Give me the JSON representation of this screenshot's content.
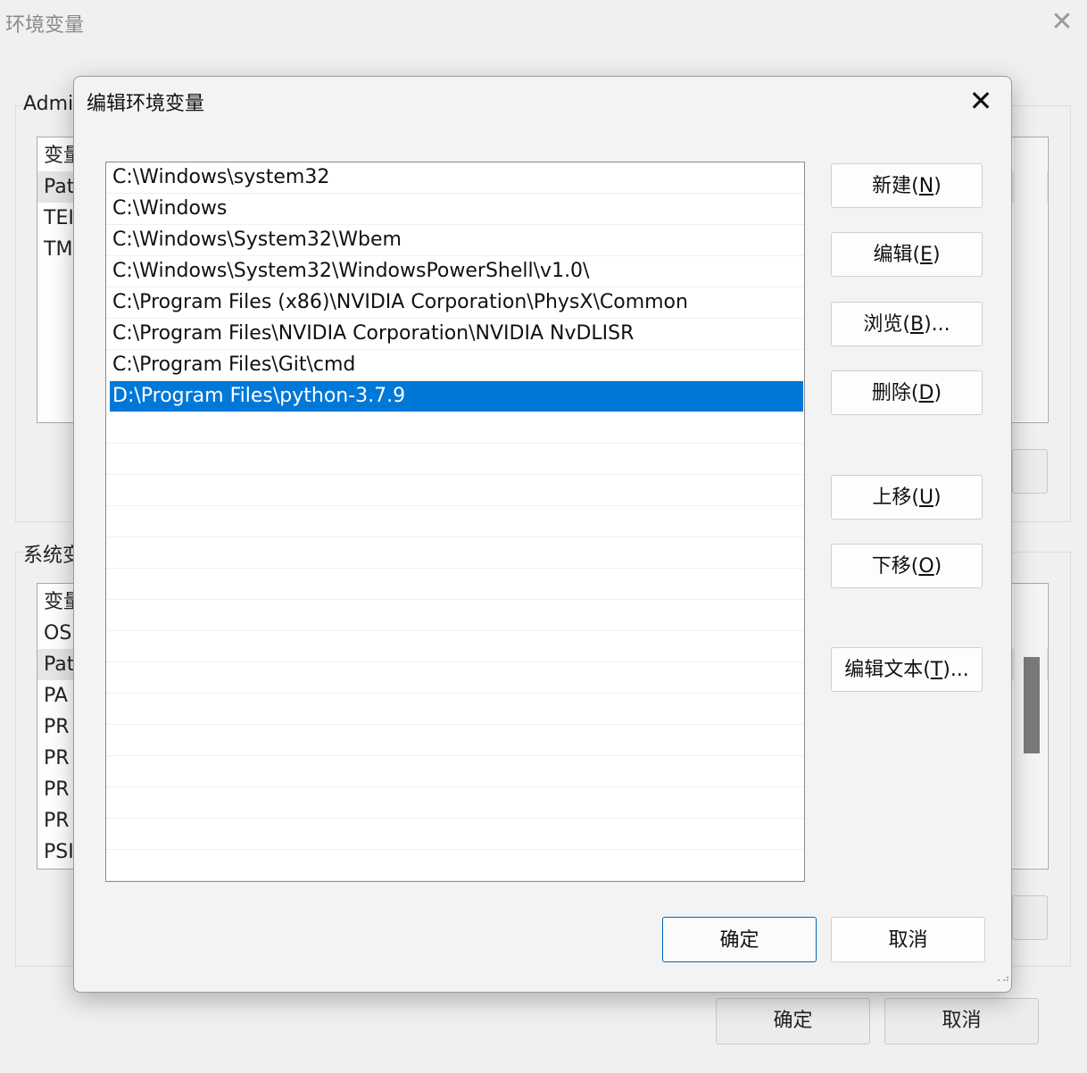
{
  "background_window": {
    "title": "环境变量",
    "user_group_label": "Admi",
    "user_vars": [
      "变量",
      "Pat",
      "TEI",
      "TM"
    ],
    "system_group_label": "系统变",
    "system_vars": [
      "变量",
      "OS",
      "Pat",
      "PA",
      "PR",
      "PR",
      "PR",
      "PR",
      "PSI"
    ],
    "ok_label": "确定",
    "cancel_label": "取消"
  },
  "dialog": {
    "title": "编辑环境变量",
    "paths": [
      "C:\\Windows\\system32",
      "C:\\Windows",
      "C:\\Windows\\System32\\Wbem",
      "C:\\Windows\\System32\\WindowsPowerShell\\v1.0\\",
      "C:\\Program Files (x86)\\NVIDIA Corporation\\PhysX\\Common",
      "C:\\Program Files\\NVIDIA Corporation\\NVIDIA NvDLISR",
      "C:\\Program Files\\Git\\cmd",
      "D:\\Program Files\\python-3.7.9"
    ],
    "selected_index": 7,
    "buttons": {
      "new": {
        "label": "新建(",
        "key": "N",
        "suffix": ")"
      },
      "edit": {
        "label": "编辑(",
        "key": "E",
        "suffix": ")"
      },
      "browse": {
        "label": "浏览(",
        "key": "B",
        "suffix": ")..."
      },
      "delete": {
        "label": "删除(",
        "key": "D",
        "suffix": ")"
      },
      "move_up": {
        "label": "上移(",
        "key": "U",
        "suffix": ")"
      },
      "move_down": {
        "label": "下移(",
        "key": "O",
        "suffix": ")"
      },
      "edit_text": {
        "label": "编辑文本(",
        "key": "T",
        "suffix": ")..."
      }
    },
    "ok_label": "确定",
    "cancel_label": "取消"
  },
  "colors": {
    "selection": "#0078d7",
    "default_button_border": "#0067c0"
  }
}
